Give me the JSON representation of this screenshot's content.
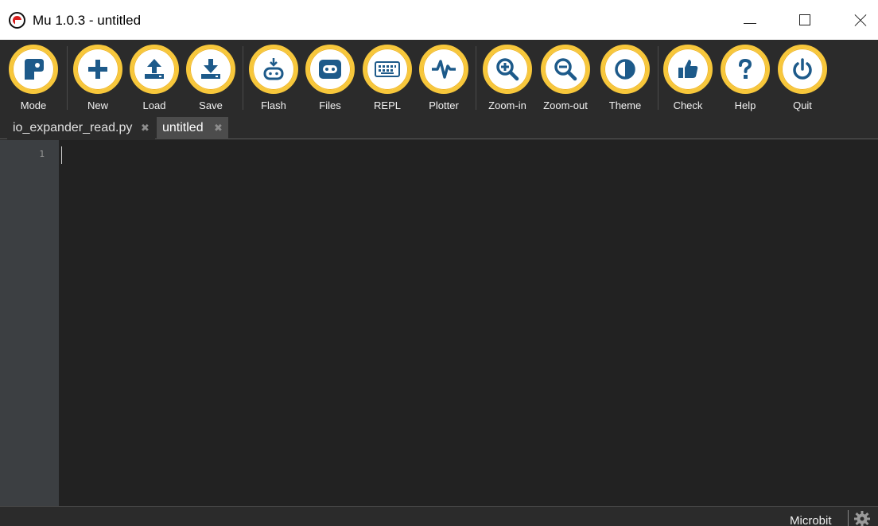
{
  "window": {
    "title": "Mu 1.0.3 - untitled"
  },
  "toolbar": {
    "buttons": [
      {
        "label": "Mode",
        "icon": "mode-icon"
      },
      {
        "label": "New",
        "icon": "plus-icon"
      },
      {
        "label": "Load",
        "icon": "upload-icon"
      },
      {
        "label": "Save",
        "icon": "download-icon"
      },
      {
        "label": "Flash",
        "icon": "flash-icon"
      },
      {
        "label": "Files",
        "icon": "microbit-icon"
      },
      {
        "label": "REPL",
        "icon": "keyboard-icon"
      },
      {
        "label": "Plotter",
        "icon": "pulse-icon"
      },
      {
        "label": "Zoom-in",
        "icon": "zoom-in-icon"
      },
      {
        "label": "Zoom-out",
        "icon": "zoom-out-icon"
      },
      {
        "label": "Theme",
        "icon": "theme-icon"
      },
      {
        "label": "Check",
        "icon": "thumbs-up-icon"
      },
      {
        "label": "Help",
        "icon": "question-icon"
      },
      {
        "label": "Quit",
        "icon": "power-icon"
      }
    ]
  },
  "tabs": [
    {
      "label": "io_expander_read.py",
      "close": "✖",
      "active": false
    },
    {
      "label": "untitled",
      "close": "✖",
      "active": true
    }
  ],
  "editor": {
    "line_numbers": [
      "1"
    ],
    "content": ""
  },
  "statusbar": {
    "mode": "Microbit",
    "settings_icon": "gear-icon"
  },
  "colors": {
    "button_ring": "#f7c73b",
    "icon": "#1d5a8a",
    "editor_bg": "#222222",
    "gutter_bg": "#3c3f42",
    "toolbar_bg": "#2b2b2b",
    "active_tab": "#4c4c4c"
  }
}
